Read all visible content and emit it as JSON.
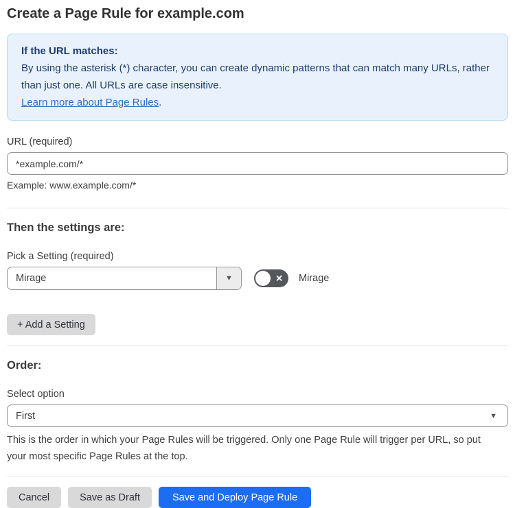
{
  "page": {
    "title": "Create a Page Rule for example.com"
  },
  "info_box": {
    "heading": "If the URL matches:",
    "body": "By using the asterisk (*) character, you can create dynamic patterns that can match many URLs, rather than just one. All URLs are case insensitive.",
    "link_label": "Learn more about Page Rules",
    "link_suffix": "."
  },
  "url_field": {
    "label": "URL (required)",
    "value": "*example.com/*",
    "helper": "Example: www.example.com/*"
  },
  "settings_section": {
    "heading": "Then the settings are:",
    "picker_label": "Pick a Setting (required)",
    "picker_value": "Mirage",
    "picker_arrow": "▼",
    "toggle_state": "off",
    "toggle_glyph": "✕",
    "toggle_label": "Mirage",
    "add_button_label": "+ Add a Setting"
  },
  "order_section": {
    "heading": "Order:",
    "select_label": "Select option",
    "select_value": "First",
    "select_arrow": "▼",
    "helper": "This is the order in which your Page Rules will be triggered. Only one Page Rule will trigger per URL, so put your most specific Page Rules at the top."
  },
  "footer": {
    "cancel_label": "Cancel",
    "save_draft_label": "Save as Draft",
    "save_deploy_label": "Save and Deploy Page Rule"
  },
  "colors": {
    "accent_blue": "#1b6ef3",
    "info_background": "#e9f2fc",
    "info_border": "#b7d7f3",
    "info_text": "#1e3c6e",
    "link_blue": "#2c6ecb",
    "toggle_off_background": "#54575c",
    "button_gray": "#d9d9d9"
  }
}
